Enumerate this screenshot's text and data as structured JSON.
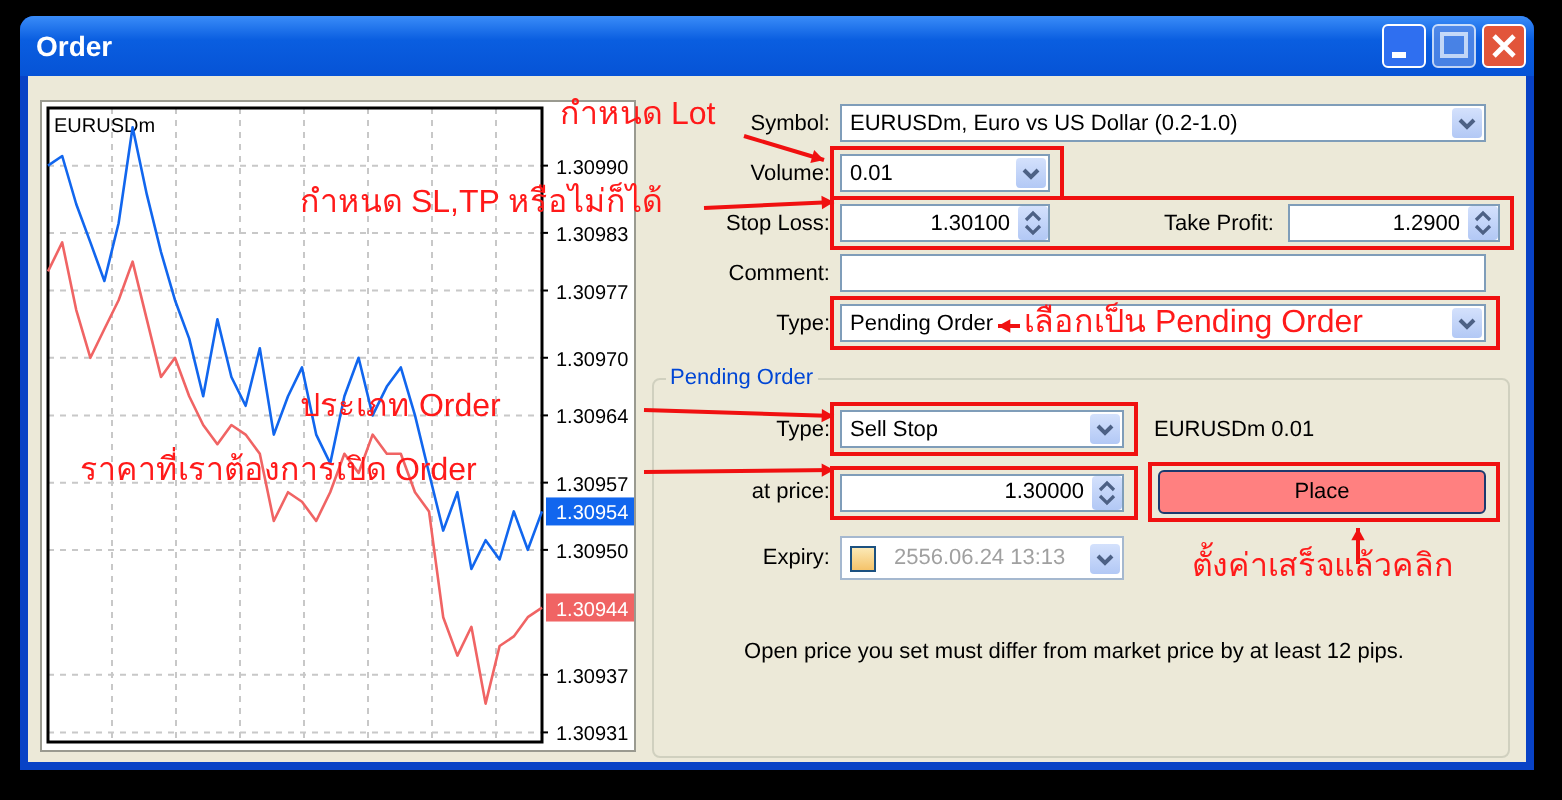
{
  "window": {
    "title": "Order"
  },
  "chart": {
    "symbol": "EURUSDm",
    "last_prices": [
      {
        "text": "1.30954",
        "color": "#1166ee"
      },
      {
        "text": "1.30944",
        "color": "#f06464"
      }
    ],
    "chart_data": {
      "type": "line",
      "grid": true,
      "ylim": [
        1.3093,
        1.30996
      ],
      "yticks": [
        {
          "value": 1.3099,
          "label": "1.30990"
        },
        {
          "value": 1.30983,
          "label": "1.30983"
        },
        {
          "value": 1.30977,
          "label": "1.30977"
        },
        {
          "value": 1.3097,
          "label": "1.30970"
        },
        {
          "value": 1.30964,
          "label": "1.30964"
        },
        {
          "value": 1.30957,
          "label": "1.30957"
        },
        {
          "value": 1.3095,
          "label": "1.30950"
        },
        {
          "value": 1.30937,
          "label": "1.30937"
        },
        {
          "value": 1.30931,
          "label": "1.30931"
        }
      ],
      "series": [
        {
          "color": "#1166ee",
          "values": [
            1.3099,
            1.30991,
            1.30986,
            1.30982,
            1.30978,
            1.30984,
            1.30994,
            1.30987,
            1.30981,
            1.30976,
            1.30972,
            1.30966,
            1.30974,
            1.30968,
            1.30965,
            1.30971,
            1.30962,
            1.30966,
            1.30969,
            1.30962,
            1.30959,
            1.30966,
            1.3097,
            1.30964,
            1.30967,
            1.30969,
            1.30964,
            1.30958,
            1.30952,
            1.30956,
            1.30948,
            1.30951,
            1.30949,
            1.30954,
            1.3095,
            1.30954
          ]
        },
        {
          "color": "#f06464",
          "values": [
            1.30979,
            1.30982,
            1.30975,
            1.3097,
            1.30973,
            1.30976,
            1.3098,
            1.30974,
            1.30968,
            1.3097,
            1.30966,
            1.30963,
            1.30961,
            1.30963,
            1.30962,
            1.3096,
            1.30953,
            1.30956,
            1.30955,
            1.30953,
            1.30956,
            1.3096,
            1.30958,
            1.30962,
            1.3096,
            1.3096,
            1.30956,
            1.30954,
            1.30943,
            1.30939,
            1.30942,
            1.30934,
            1.3094,
            1.30941,
            1.30943,
            1.30944
          ]
        }
      ]
    }
  },
  "form": {
    "symbol": {
      "label": "Symbol:",
      "value": "EURUSDm, Euro vs US Dollar (0.2-1.0)"
    },
    "volume": {
      "label": "Volume:",
      "value": "0.01",
      "highlighted": true
    },
    "stops": {
      "highlighted": true,
      "stop_loss": {
        "label": "Stop Loss:",
        "value": "1.30100"
      },
      "take_profit": {
        "label": "Take Profit:",
        "value": "1.2900"
      }
    },
    "comment": {
      "label": "Comment:"
    },
    "type": {
      "label": "Type:",
      "value": "Pending Order",
      "highlighted": true
    }
  },
  "pending": {
    "legend": "Pending Order",
    "type": {
      "label": "Type:",
      "value": "Sell Stop",
      "highlighted": true
    },
    "summary": "EURUSDm 0.01",
    "price": {
      "label": "at price:",
      "value": "1.30000",
      "highlighted": true
    },
    "place_button": {
      "label": "Place",
      "highlighted": true
    },
    "expiry": {
      "label": "Expiry:",
      "value": "2556.06.24 13:13",
      "checked": false,
      "disabled": true
    },
    "note": "Open price you set must differ from market price by at least 12 pips."
  },
  "annotations": [
    {
      "text": "กำหนด Lot"
    },
    {
      "text": "กำหนด SL,TP หรือไม่ก็ได้"
    },
    {
      "text": "เลือกเป็น Pending Order"
    },
    {
      "text": "ประเภท Order"
    },
    {
      "text": "ราคาที่เราต้องการเปิด Order"
    },
    {
      "text": "ตั้งค่าเสร็จแล้วคลิก"
    }
  ]
}
